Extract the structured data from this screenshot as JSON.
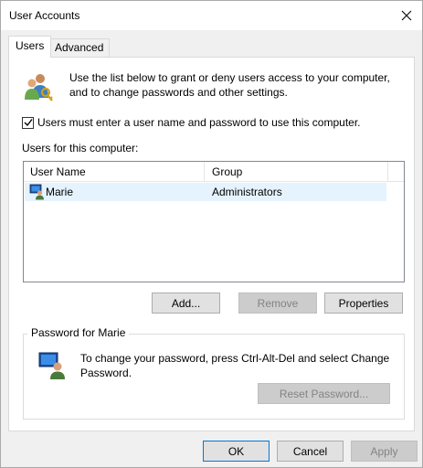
{
  "window": {
    "title": "User Accounts"
  },
  "tabs": [
    {
      "label": "Users",
      "active": true
    },
    {
      "label": "Advanced",
      "active": false
    }
  ],
  "intro": {
    "text": "Use the list below to grant or deny users access to your computer, and to change passwords and other settings.",
    "icon": "users-keys-icon"
  },
  "checkbox": {
    "label": "Users must enter a user name and password to use this computer.",
    "checked": true
  },
  "users_label": "Users for this computer:",
  "list": {
    "columns": [
      "User Name",
      "Group"
    ],
    "rows": [
      {
        "name": "Marie",
        "group": "Administrators",
        "selected": true,
        "icon": "user-monitor-icon"
      }
    ]
  },
  "list_buttons": {
    "add": "Add...",
    "remove": "Remove",
    "properties": "Properties"
  },
  "password": {
    "group_label": "Password for Marie",
    "text": "To change your password, press Ctrl-Alt-Del and select Change Password.",
    "reset": "Reset Password..."
  },
  "footer": {
    "ok": "OK",
    "cancel": "Cancel",
    "apply": "Apply"
  },
  "colors": {
    "selection": "#e5f3ff",
    "accent": "#0078d7",
    "panel": "#ffffff",
    "window_bg": "#f0f0f0"
  }
}
